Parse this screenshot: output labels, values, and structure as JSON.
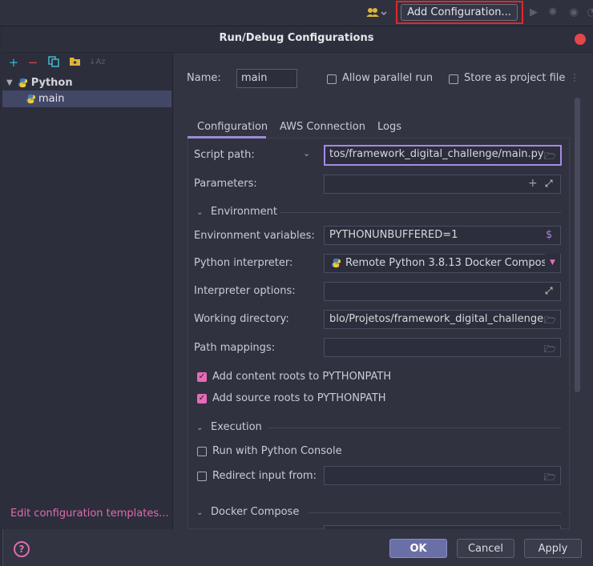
{
  "toolbar": {
    "add_configuration_label": "Add Configuration..."
  },
  "dialog": {
    "title": "Run/Debug Configurations"
  },
  "sidebar": {
    "tree": [
      {
        "label": "Python"
      },
      {
        "label": "main"
      }
    ],
    "edit_templates_link": "Edit configuration templates..."
  },
  "form": {
    "name_label": "Name:",
    "name_value": "main",
    "allow_parallel_label": "Allow parallel run",
    "store_project_label": "Store as project file",
    "tabs": [
      "Configuration",
      "AWS Connection",
      "Logs"
    ],
    "script_path_label": "Script path:",
    "script_path_value": "tos/framework_digital_challenge/main.py",
    "parameters_label": "Parameters:",
    "parameters_value": "",
    "environment_section": "Environment",
    "env_vars_label": "Environment variables:",
    "env_vars_value": "PYTHONUNBUFFERED=1",
    "interpreter_label": "Python interpreter:",
    "interpreter_value": "Remote Python 3.8.13 Docker Compos",
    "interp_options_label": "Interpreter options:",
    "interp_options_value": "",
    "working_dir_label": "Working directory:",
    "working_dir_value": "blo/Projetos/framework_digital_challenge",
    "path_mappings_label": "Path mappings:",
    "path_mappings_value": "",
    "content_roots_label": "Add content roots to PYTHONPATH",
    "content_roots_checked": true,
    "source_roots_label": "Add source roots to PYTHONPATH",
    "source_roots_checked": true,
    "execution_section": "Execution",
    "python_console_label": "Run with Python Console",
    "python_console_checked": false,
    "redirect_input_label": "Redirect input from:",
    "redirect_input_checked": false,
    "redirect_input_value": "",
    "docker_compose_section": "Docker Compose"
  },
  "buttons": {
    "ok": "OK",
    "cancel": "Cancel",
    "apply": "Apply",
    "help": "?"
  },
  "colors": {
    "accent": "#a58be4",
    "checkbox_on": "#e66bb7",
    "highlight_box": "#e3262b",
    "link": "#e06bb0"
  }
}
